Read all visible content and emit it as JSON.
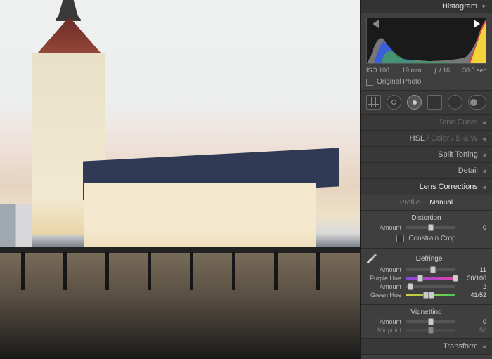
{
  "header": {
    "title": "Histogram"
  },
  "histogram": {
    "iso": "ISO 100",
    "focal": "19 mm",
    "aperture": "ƒ / 16",
    "shutter": "30.0 sec",
    "original_label": "Original Photo"
  },
  "sections": {
    "tone_curve": "Tone Curve",
    "hsl": "HSL",
    "color": "Color",
    "bw": "B & W",
    "split_toning": "Split Toning",
    "detail": "Detail",
    "lens_corrections": "Lens Corrections",
    "transform": "Transform"
  },
  "lens": {
    "tabs": {
      "profile": "Profile",
      "manual": "Manual"
    },
    "distortion": {
      "title": "Distortion",
      "amount_label": "Amount",
      "amount_value": "0",
      "constrain_label": "Constrain Crop"
    },
    "defringe": {
      "title": "Defringe",
      "amount1_label": "Amount",
      "amount1_value": "11",
      "purple_label": "Purple Hue",
      "purple_value": "30/100",
      "amount2_label": "Amount",
      "amount2_value": "2",
      "green_label": "Green Hue",
      "green_value": "41/52"
    },
    "vignetting": {
      "title": "Vignetting",
      "amount_label": "Amount",
      "amount_value": "0",
      "midpoint_label": "Midpoint",
      "midpoint_value": "50"
    }
  }
}
